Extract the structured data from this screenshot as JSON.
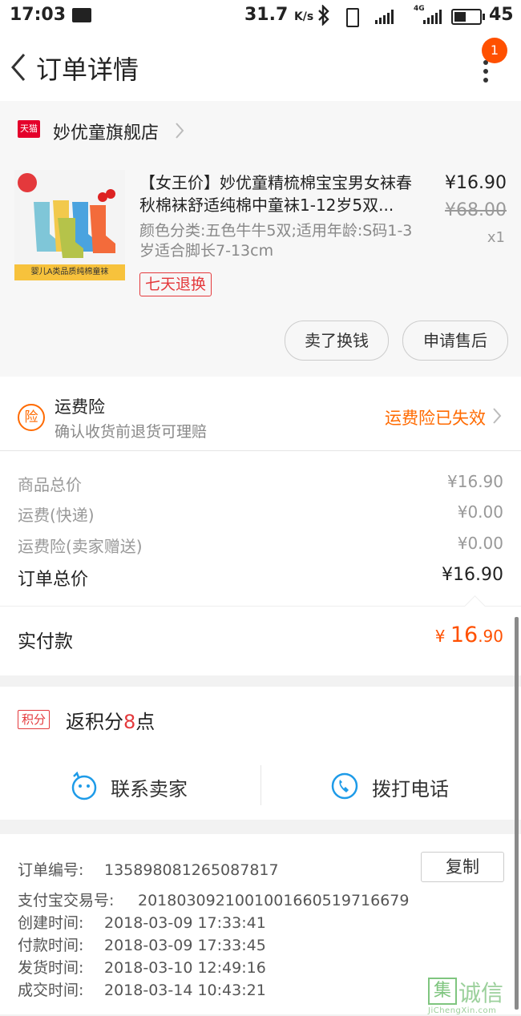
{
  "status_bar": {
    "time": "17:03",
    "speed": "31.7",
    "speed_unit": "K/s",
    "network": "4G",
    "battery": "45"
  },
  "nav": {
    "title": "订单详情",
    "badge": "1"
  },
  "shop": {
    "logo": "天猫",
    "name": "妙优童旗舰店"
  },
  "product": {
    "image_banner": "婴儿A类品质纯棉童袜",
    "title": "【女王价】妙优童精梳棉宝宝男女袜春秋棉袜舒适纯棉中童袜1-12岁5双...",
    "sku": "颜色分类:五色牛牛5双;适用年龄:S码1-3岁适合脚长7-13cm",
    "tag": "七天退换",
    "price": "¥16.90",
    "original_price": "¥68.00",
    "quantity": "x1",
    "actions": [
      "卖了换钱",
      "申请售后"
    ]
  },
  "insurance": {
    "icon_char": "险",
    "title": "运费险",
    "subtitle": "确认收货前退货可理赔",
    "status": "运费险已失效"
  },
  "fees": [
    {
      "label": "商品总价",
      "value": "¥16.90"
    },
    {
      "label": "运费(快递)",
      "value": "¥0.00"
    },
    {
      "label": "运费险(卖家赠送)",
      "value": "¥0.00"
    },
    {
      "label": "订单总价",
      "value": "¥16.90"
    }
  ],
  "paid": {
    "label": "实付款",
    "currency": "¥",
    "amount_int": "16",
    "amount_dec": ".90"
  },
  "points": {
    "badge": "积分",
    "prefix": "返积分",
    "count": "8",
    "suffix": "点"
  },
  "contact": {
    "seller": "联系卖家",
    "phone": "拨打电话"
  },
  "order_info": {
    "copy_label": "复制",
    "rows": [
      {
        "label": "订单编号:",
        "value": "135898081265087817"
      },
      {
        "label": "支付宝交易号:",
        "value": "2018030921001001660519716679"
      },
      {
        "label": "创建时间:",
        "value": "2018-03-09 17:33:41"
      },
      {
        "label": "付款时间:",
        "value": "2018-03-09 17:33:45"
      },
      {
        "label": "发货时间:",
        "value": "2018-03-10 12:49:16"
      },
      {
        "label": "成交时间:",
        "value": "2018-03-14 10:43:21"
      }
    ]
  },
  "watermark": {
    "mark": "集",
    "chinese": "诚信",
    "domain": "JiChengXin.com"
  },
  "colors": {
    "accent_orange": "#ff5000",
    "tmall_red": "#e4002b",
    "tag_red": "#e4393c",
    "contact_blue": "#1e9be8"
  }
}
